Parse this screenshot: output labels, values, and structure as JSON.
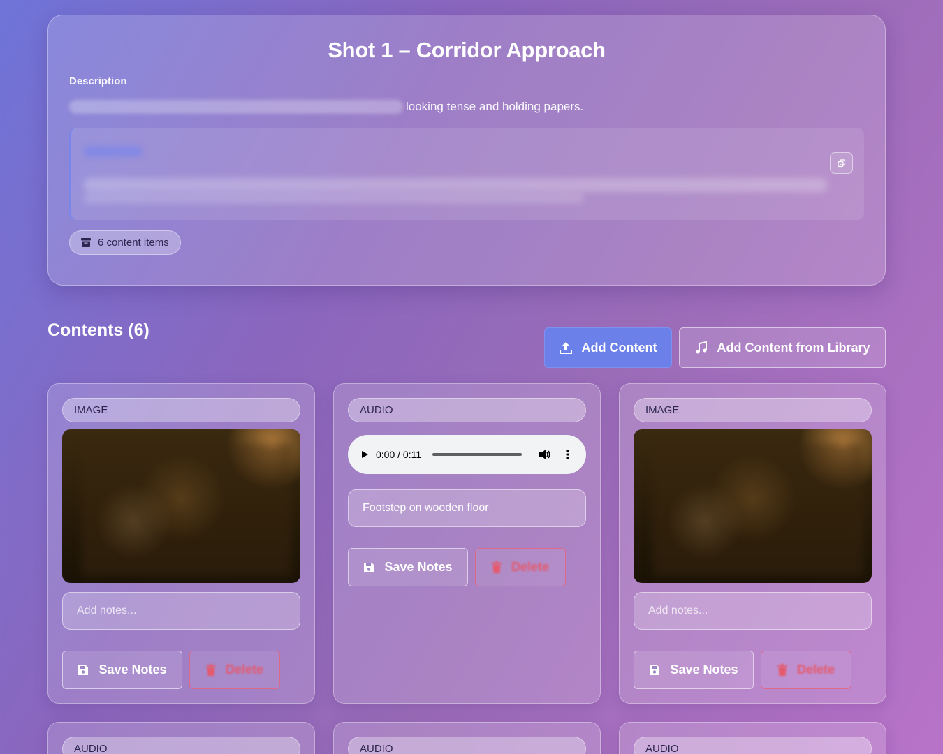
{
  "shot": {
    "title": "Shot 1 – Corridor Approach",
    "description_label": "Description",
    "description_visible_text": "looking tense and holding papers.",
    "content_count_label": "6 content items"
  },
  "contents": {
    "title": "Contents (6)",
    "add_content_label": "Add Content",
    "add_from_library_label": "Add Content from Library"
  },
  "cards": [
    {
      "type": "IMAGE",
      "notes_placeholder": "Add notes...",
      "save_label": "Save Notes",
      "delete_label": "Delete"
    },
    {
      "type": "AUDIO",
      "audio_time": "0:00 / 0:11",
      "notes_value": "Footstep on wooden floor",
      "save_label": "Save Notes",
      "delete_label": "Delete"
    },
    {
      "type": "IMAGE",
      "notes_placeholder": "Add notes...",
      "save_label": "Save Notes",
      "delete_label": "Delete"
    },
    {
      "type": "AUDIO"
    },
    {
      "type": "AUDIO"
    },
    {
      "type": "AUDIO"
    }
  ],
  "icons": {
    "count_badge": "archive-icon",
    "copy": "copy-icon",
    "add_content": "upload-icon",
    "library": "music-note-icon",
    "save": "floppy-disk-icon",
    "delete": "trash-icon"
  },
  "colors": {
    "primary": "#6c80ea",
    "danger": "#e5596b"
  }
}
